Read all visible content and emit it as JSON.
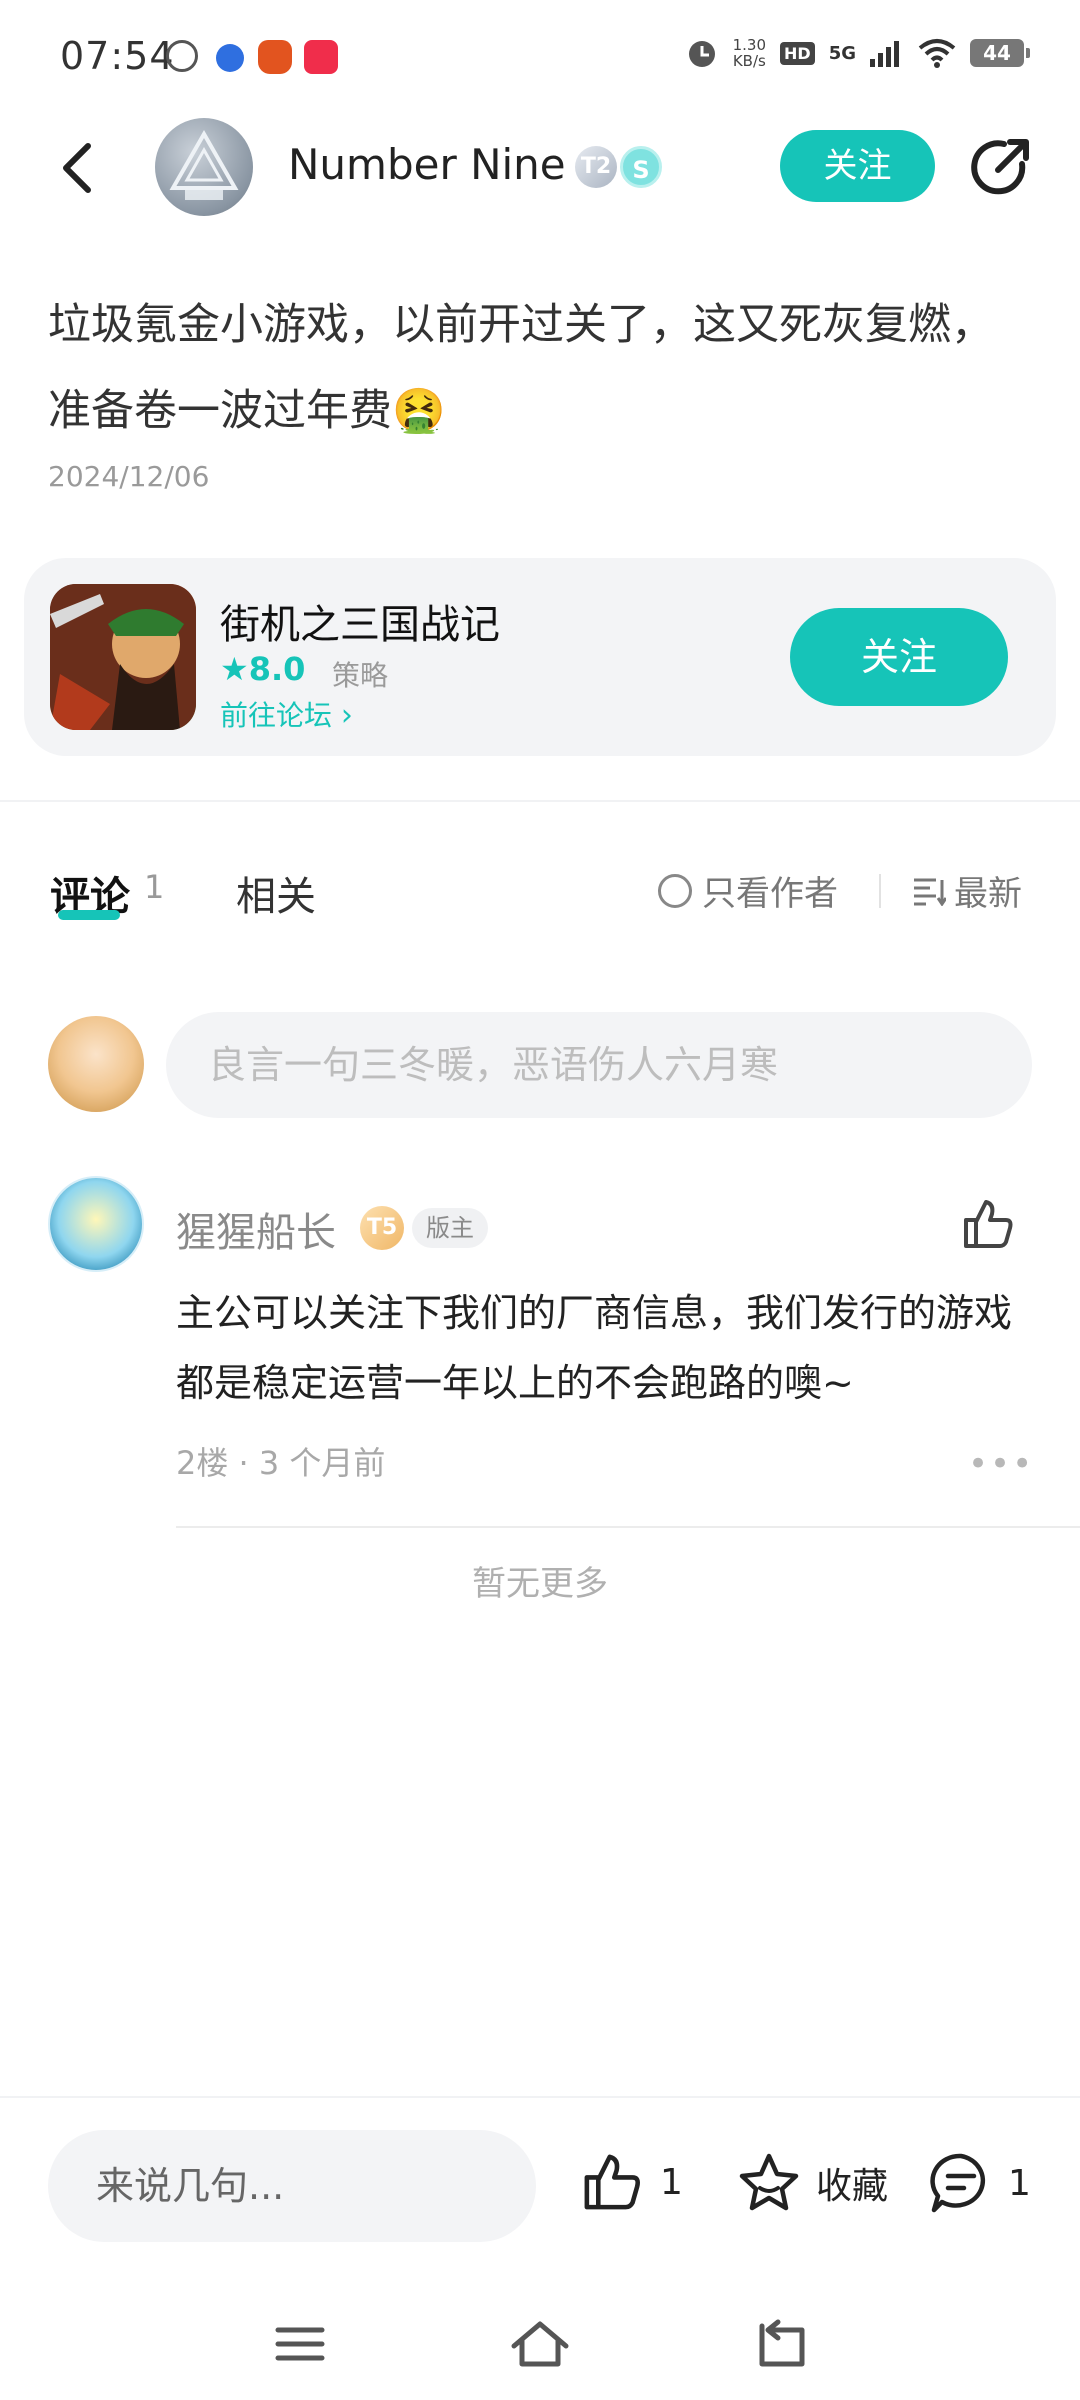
{
  "status_bar": {
    "time": "07:54",
    "net_speed_value": "1.30",
    "net_speed_unit": "KB/s",
    "hd": "HD",
    "network": "5G",
    "battery": "44",
    "icons": [
      "k-icon",
      "paw-icon",
      "pumpkin-icon",
      "app-red-icon",
      "alarm-icon",
      "signal-icon",
      "wifi-icon",
      "battery-icon"
    ]
  },
  "header": {
    "author_name": "Number Nine",
    "badge_level": "T2",
    "badge_s": "S",
    "follow_label": "关注"
  },
  "post": {
    "body": "垃圾氪金小游戏，以前开过关了，这又死灰复燃，准备卷一波过年费🤮",
    "date": "2024/12/06"
  },
  "game_card": {
    "name": "街机之三国战记",
    "rating": "8.0",
    "genre": "策略",
    "forum_link": "前往论坛",
    "follow_label": "关注"
  },
  "tabs": {
    "comments_label": "评论",
    "comments_count": "1",
    "related_label": "相关",
    "author_only_label": "只看作者",
    "sort_label": "最新"
  },
  "comment_input": {
    "placeholder": "良言一句三冬暖，恶语伤人六月寒"
  },
  "comments": [
    {
      "username": "猩猩船长",
      "level": "T5",
      "role_badge": "版主",
      "text": "主公可以关注下我们的厂商信息，我们发行的游戏都是稳定运营一年以上的不会跑路的噢~",
      "floor": "2楼",
      "time": "3 个月前"
    }
  ],
  "no_more": "暂无更多",
  "bottom_bar": {
    "reply_placeholder": "来说几句...",
    "like_count": "1",
    "favorite_label": "收藏",
    "comment_count": "1"
  },
  "colors": {
    "accent": "#16c4b8",
    "text_primary": "#222222",
    "text_secondary": "#9a9a9a",
    "card_bg": "#f3f4f6"
  }
}
